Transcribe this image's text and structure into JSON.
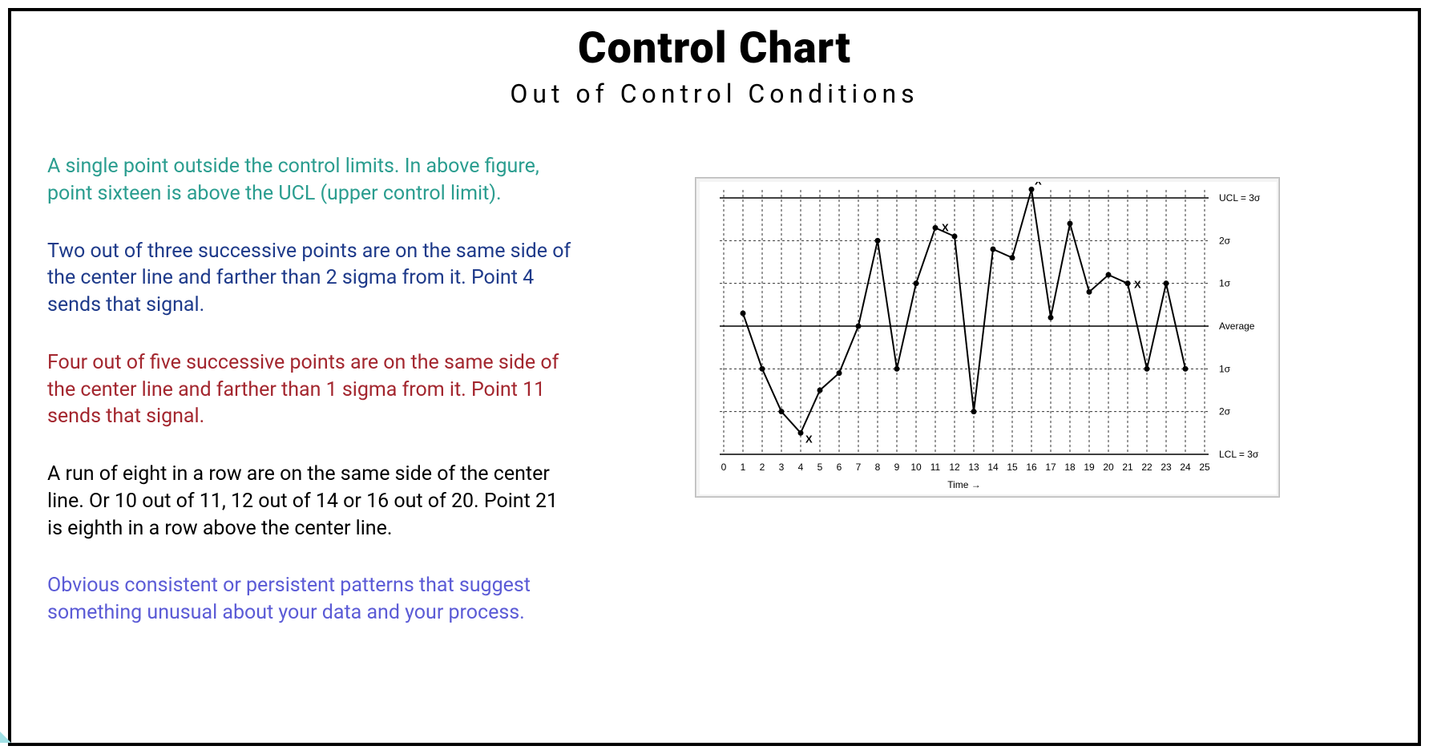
{
  "header": {
    "title": "Control Chart",
    "subtitle": "Out of Control Conditions"
  },
  "rules": [
    {
      "color": "c-teal",
      "text": "A single point outside the control limits. In above figure, point sixteen is above the UCL (upper control limit)."
    },
    {
      "color": "c-navy",
      "text": "Two out of three successive points are on the same side of the center line and farther than 2 sigma from it. Point 4 sends that signal."
    },
    {
      "color": "c-red",
      "text": "Four out of five successive points are on the same side of the center line and farther than 1 sigma from it. Point 11 sends that signal."
    },
    {
      "color": "c-black",
      "text": "A run of eight in a row are on the same side of the center line. Or 10 out of 11, 12 out of 14 or 16 out of 20. Point 21 is eighth in a row above the center line."
    },
    {
      "color": "c-purple",
      "text": "Obvious consistent or persistent patterns that suggest something unusual about your data and your process."
    }
  ],
  "chart_data": {
    "type": "line",
    "title": "",
    "xlabel": "Time",
    "ylabel": "",
    "x": [
      1,
      2,
      3,
      4,
      5,
      6,
      7,
      8,
      9,
      10,
      11,
      12,
      13,
      14,
      15,
      16,
      17,
      18,
      19,
      20,
      21,
      22,
      23,
      24
    ],
    "values": [
      0.3,
      -1.0,
      -2.0,
      -2.5,
      -1.5,
      -1.1,
      0.0,
      2.0,
      -1.0,
      1.0,
      2.3,
      2.1,
      -2.0,
      1.8,
      1.6,
      3.2,
      0.2,
      2.4,
      0.8,
      1.2,
      1.0,
      -1.0,
      1.0,
      -1.0
    ],
    "marked_points": [
      4,
      11,
      16,
      21
    ],
    "sigma_lines": {
      "ucl": "UCL = 3σ",
      "p2s": "2σ",
      "p1s": "1σ",
      "avg": "Average",
      "m1s": "1σ",
      "m2s": "2σ",
      "lcl": "LCL = 3σ"
    },
    "ylim": [
      -3,
      3
    ],
    "xlim": [
      0,
      25
    ],
    "x_ticks": [
      0,
      1,
      2,
      3,
      4,
      5,
      6,
      7,
      8,
      9,
      10,
      11,
      12,
      13,
      14,
      15,
      16,
      17,
      18,
      19,
      20,
      21,
      22,
      23,
      24,
      25
    ]
  }
}
